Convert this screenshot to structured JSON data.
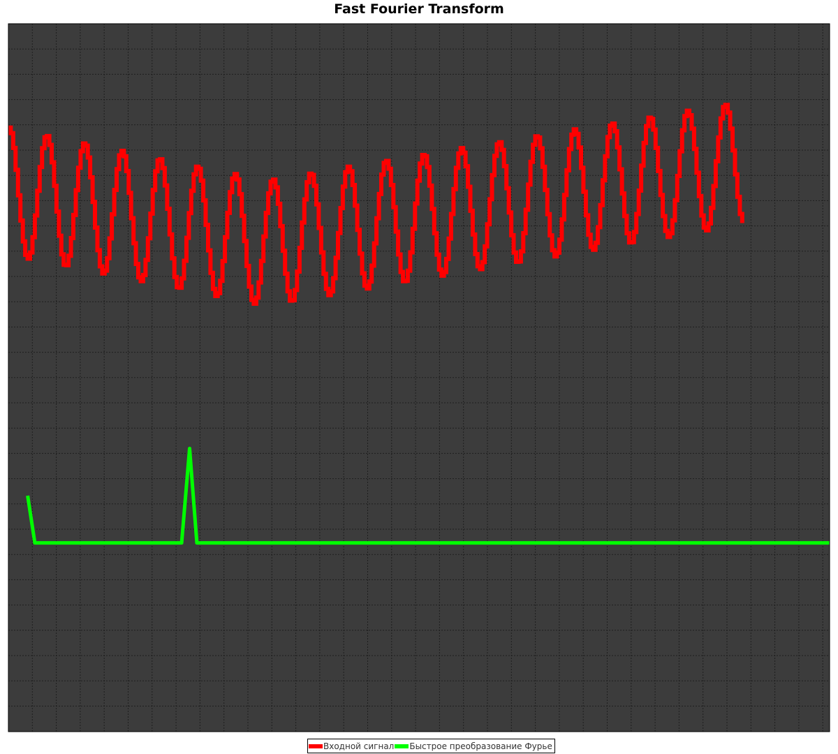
{
  "title": "Fast Fourier Transform",
  "legend": {
    "input_label": "Входной сигнал",
    "fft_label": "Быстрое преобразование Фурье"
  },
  "colors": {
    "background": "#3c3c3c",
    "grid": "#1e1e1e",
    "input": "#ff0000",
    "fft": "#00ff00"
  },
  "chart_data": {
    "type": "line",
    "title": "Fast Fourier Transform",
    "grid": true,
    "legend_position": "bottom-center",
    "xlim": [
      0,
      1024
    ],
    "ylim": [
      -2,
      1
    ],
    "series": [
      {
        "name": "Входной сигнал",
        "x_start": 0,
        "x_step": 3,
        "x_end": 915,
        "cycle_length": 47,
        "phase_deg": 90,
        "amp_start": 0.27,
        "amp_end": 0.26,
        "center_start": 0.29,
        "center_mid": 0.07,
        "center_end": 0.41,
        "sample_step": 3
      },
      {
        "name": "Быстрое преобразование Фурье",
        "x": [
          24,
          33,
          216,
          226,
          235,
          1024
        ],
        "y": [
          -1.0,
          -1.2,
          -1.2,
          -0.8,
          -1.2,
          -1.2
        ]
      }
    ]
  }
}
